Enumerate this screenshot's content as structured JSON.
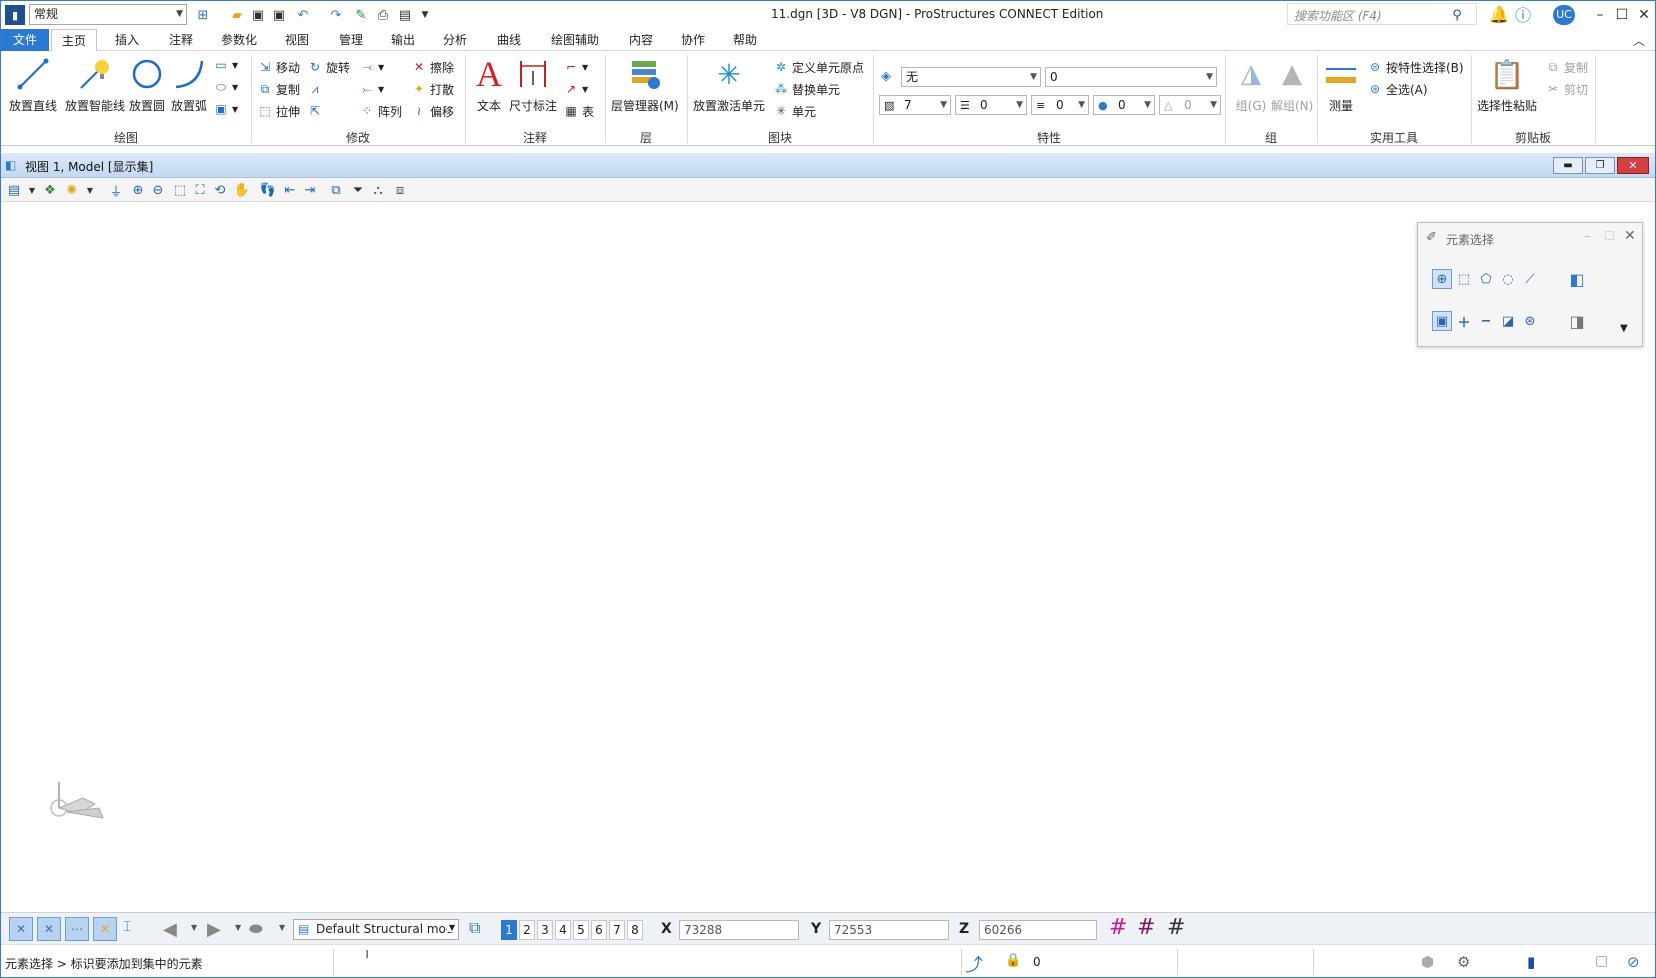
{
  "titlebar": {
    "workspace": "常规",
    "title": "11.dgn [3D - V8 DGN] - ProStructures CONNECT Edition",
    "search_placeholder": "搜索功能区 (F4)",
    "user": "UC"
  },
  "menu": [
    "文件",
    "主页",
    "插入",
    "注释",
    "参数化",
    "视图",
    "管理",
    "输出",
    "分析",
    "曲线",
    "绘图辅助",
    "内容",
    "协作",
    "帮助"
  ],
  "ribbon": {
    "draw": {
      "label": "绘图",
      "line": "放置直线",
      "smartline": "放置智能线",
      "circle": "放置圆",
      "arc": "放置弧"
    },
    "modify": {
      "label": "修改",
      "move": "移动",
      "rotate": "旋转",
      "copy": "复制",
      "stretch": "拉伸",
      "array": "阵列",
      "erase": "擦除",
      "drop": "打散",
      "offset": "偏移"
    },
    "annotate": {
      "label": "注释",
      "text": "文本",
      "dimension": "尺寸标注",
      "table": "表"
    },
    "layer": {
      "label": "层",
      "manager": "层管理器(M)"
    },
    "cell": {
      "label": "图块",
      "place_active": "放置激活单元",
      "define_origin": "定义单元原点",
      "replace": "替换单元",
      "cell": "单元"
    },
    "attributes": {
      "label": "特性",
      "level": "无",
      "color": "0",
      "weight": "7",
      "style": "0",
      "weight2": "0",
      "transparency": "0",
      "priority": "0"
    },
    "group": {
      "label": "组",
      "group": "组(G)",
      "ungroup": "解组(N)"
    },
    "utilities": {
      "label": "实用工具",
      "measure": "测量",
      "select_by_attr": "按特性选择(B)",
      "select_all": "全选(A)"
    },
    "clipboard": {
      "label": "剪贴板",
      "paste_special": "选择性粘贴",
      "copy": "复制",
      "cut": "剪切"
    }
  },
  "view": {
    "title": "视图 1, Model [显示集]"
  },
  "element_selection": {
    "title": "元素选择"
  },
  "bottom": {
    "model": "Default Structural mod",
    "views": [
      "1",
      "2",
      "3",
      "4",
      "5",
      "6",
      "7",
      "8"
    ],
    "x_label": "X",
    "x": "73288",
    "y_label": "Y",
    "y": "72553",
    "z_label": "Z",
    "z": "60266"
  },
  "status": {
    "message": "元素选择 > 标识要添加到集中的元素",
    "lock_value": "0"
  },
  "colors": {
    "accent": "#2b79d0",
    "grid_magenta": "#c8189c",
    "text_red": "#d81e1e"
  }
}
